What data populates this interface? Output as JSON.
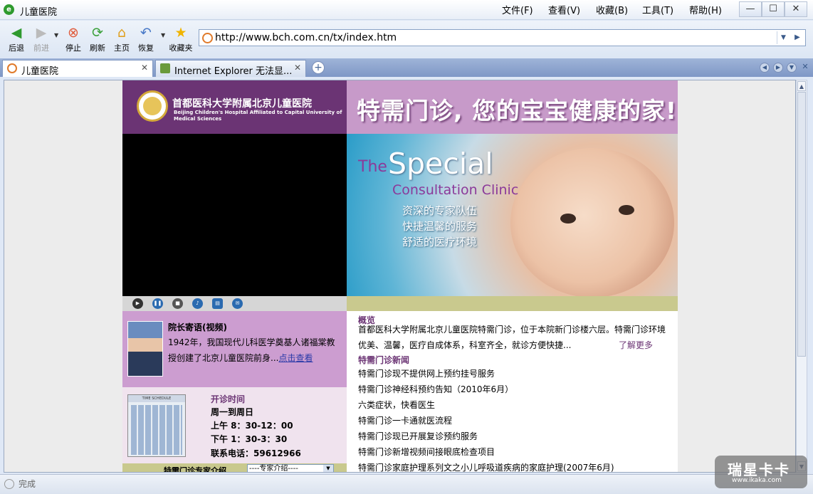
{
  "window": {
    "title": "儿童医院",
    "app_icon": "e"
  },
  "menu": [
    {
      "label": "文件(F)"
    },
    {
      "label": "查看(V)"
    },
    {
      "label": "收藏(B)"
    },
    {
      "label": "工具(T)"
    },
    {
      "label": "帮助(H)"
    }
  ],
  "toolbar": {
    "back": "后退",
    "forward": "前进",
    "stop": "停止",
    "refresh": "刷新",
    "home": "主页",
    "restore": "恢复",
    "favorites": "收藏夹"
  },
  "address": {
    "url": "http://www.bch.com.cn/tx/index.htm"
  },
  "tabs": [
    {
      "label": "儿童医院"
    },
    {
      "label": "Internet Explorer 无法显..."
    }
  ],
  "page": {
    "hospital_cn": "首都医科大学附属北京儿童医院",
    "hospital_en": "Beijing Children's Hospital Affiliated to Capital University of Medical Sciences",
    "slogan": "特需门诊, 您的宝宝健康的家!",
    "banner_the": "The",
    "banner_special": "Special",
    "banner_clinic": "Consultation Clinic",
    "banner_line1": "资深的专家队伍",
    "banner_line2": "快捷温馨的服务",
    "banner_line3": "舒适的医疗环境",
    "message_title": "院长寄语(视频)",
    "message_text": "1942年，我国现代儿科医学奠基人诸福棠教授创建了北京儿童医院前身...",
    "message_link": "点击查看",
    "schedule_title": "开诊时间",
    "schedule_days": "周一到周日",
    "schedule_am": "上午 8：30-12：00",
    "schedule_pm": "下午 1：30-3：30",
    "schedule_phone": "联系电话：59612966",
    "calendar_label": "TIME SCHEDULE",
    "expert_label": "特需门诊专家介绍",
    "expert_select": "----专家介绍----",
    "overview_title": "概览",
    "overview_text": "首都医科大学附属北京儿童医院特需门诊，位于本院新门诊楼六层。特需门诊环境优美、温馨，医疗自成体系，科室齐全，就诊方便快捷...",
    "more_link": "了解更多",
    "news_title": "特需门诊新闻",
    "news": [
      "特需门诊现不提供网上预约挂号服务",
      "特需门诊神经科预约告知（2010年6月）",
      "六类症状，快看医生",
      "特需门诊一卡通就医流程",
      "特需门诊现已开展复诊预约服务",
      "特需门诊新增视频间接眼底检查项目",
      "特需门诊家庭护理系列文之小儿呼吸道疾病的家庭护理(2007年6月)"
    ]
  },
  "status": {
    "text": "完成"
  },
  "watermark": {
    "line1": "瑞星卡卡",
    "line2": "www.ikaka.com"
  },
  "colors": {
    "brand_purple": "#6b3474",
    "header_pink": "#c79ac9",
    "olive": "#c9c98e"
  }
}
